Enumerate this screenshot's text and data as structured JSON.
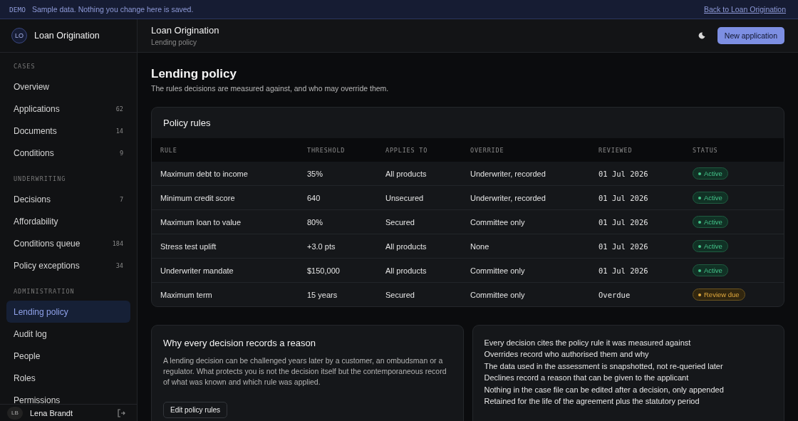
{
  "banner": {
    "tag": "DEMO",
    "message": "Sample data. Nothing you change here is saved.",
    "link": "Back to Loan Origination"
  },
  "sidebar": {
    "avatar": "LO",
    "app_name": "Loan Origination",
    "sections": [
      {
        "label": "CASES",
        "items": [
          {
            "label": "Overview",
            "selected": false
          },
          {
            "label": "Applications",
            "count": "62",
            "selected": false
          },
          {
            "label": "Documents",
            "count": "14",
            "selected": false
          },
          {
            "label": "Conditions",
            "count": "9",
            "selected": false
          }
        ]
      },
      {
        "label": "UNDERWRITING",
        "items": [
          {
            "label": "Decisions",
            "count": "7",
            "selected": false
          },
          {
            "label": "Affordability",
            "selected": false
          },
          {
            "label": "Conditions queue",
            "count": "184",
            "selected": false
          },
          {
            "label": "Policy exceptions",
            "count": "34",
            "selected": false
          }
        ]
      },
      {
        "label": "ADMINISTRATION",
        "items": [
          {
            "label": "Lending policy",
            "selected": true
          },
          {
            "label": "Audit log",
            "selected": false
          },
          {
            "label": "People",
            "selected": false
          },
          {
            "label": "Roles",
            "selected": false
          },
          {
            "label": "Permissions",
            "selected": false
          }
        ]
      }
    ],
    "user": {
      "avatar": "LB",
      "name": "Lena Brandt"
    }
  },
  "header": {
    "title": "Loan Origination",
    "breadcrumb": "Lending policy",
    "button": "New application"
  },
  "page": {
    "title": "Lending policy",
    "subtitle": "The rules decisions are measured against, and who may override them."
  },
  "table": {
    "title": "Policy rules",
    "columns": [
      "RULE",
      "THRESHOLD",
      "APPLIES TO",
      "OVERRIDE",
      "REVIEWED",
      "STATUS"
    ],
    "rows": [
      {
        "rule": "Maximum debt to income",
        "threshold": "35%",
        "applies_to": "All products",
        "override": "Underwriter, recorded",
        "reviewed": "01 Jul 2026",
        "status": "Active",
        "kind": "active"
      },
      {
        "rule": "Minimum credit score",
        "threshold": "640",
        "applies_to": "Unsecured",
        "override": "Underwriter, recorded",
        "reviewed": "01 Jul 2026",
        "status": "Active",
        "kind": "active"
      },
      {
        "rule": "Maximum loan to value",
        "threshold": "80%",
        "applies_to": "Secured",
        "override": "Committee only",
        "reviewed": "01 Jul 2026",
        "status": "Active",
        "kind": "active"
      },
      {
        "rule": "Stress test uplift",
        "threshold": "+3.0 pts",
        "applies_to": "All products",
        "override": "None",
        "reviewed": "01 Jul 2026",
        "status": "Active",
        "kind": "active"
      },
      {
        "rule": "Underwriter mandate",
        "threshold": "$150,000",
        "applies_to": "All products",
        "override": "Committee only",
        "reviewed": "01 Jul 2026",
        "status": "Active",
        "kind": "active"
      },
      {
        "rule": "Maximum term",
        "threshold": "15 years",
        "applies_to": "Secured",
        "override": "Committee only",
        "reviewed": "Overdue",
        "status": "Review due",
        "kind": "warning"
      }
    ]
  },
  "explainer": {
    "title": "Why every decision records a reason",
    "body": "A lending decision can be challenged years later by a customer, an ombudsman or a regulator. What protects you is not the decision itself but the contemporaneous record of what was known and which rule was applied.",
    "button": "Edit policy rules"
  },
  "principles": [
    "Every decision cites the policy rule it was measured against",
    "Overrides record who authorised them and why",
    "The data used in the assessment is snapshotted, not re-queried later",
    "Declines record a reason that can be given to the applicant",
    "Nothing in the case file can be edited after a decision, only appended",
    "Retained for the life of the agreement plus the statutory period"
  ]
}
